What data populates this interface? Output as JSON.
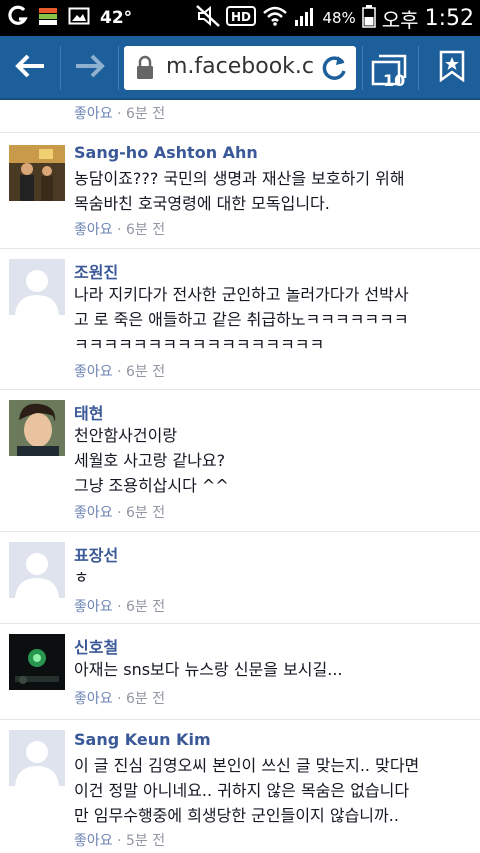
{
  "status_bar": {
    "temperature": "42°",
    "battery_percent": "48%",
    "ampm": "오후",
    "time": "1:52",
    "icons": [
      "g-icon",
      "flag-icon",
      "image-icon",
      "mute-icon",
      "hd-icon",
      "wifi-icon",
      "signal-icon",
      "battery-icon"
    ]
  },
  "browser": {
    "url": "m.facebook.c",
    "tab_count": "10",
    "colors": {
      "toolbar": "#1d5f9a",
      "url_text": "#333333"
    }
  },
  "first_meta": {
    "like": "좋아요",
    "time": "6분 전"
  },
  "comments": [
    {
      "name": "Sang-ho Ashton Ahn",
      "lines": [
        "농담이죠??? 국민의 생명과 재산을 보호하기 위해",
        "목숨바친 호국영령에 대한 모독입니다."
      ],
      "like": "좋아요",
      "time": "6분 전",
      "avatar": "photo"
    },
    {
      "name": "조원진",
      "lines": [
        "나라 지키다가 전사한 군인하고 놀러가다가 선박사",
        "고 로 죽은 애들하고 같은 취급하노ㅋㅋㅋㅋㅋㅋㅋ",
        "ㅋㅋㅋㅋㅋㅋㅋㅋㅋㅋㅋㅋㅋㅋㅋㅋㅋ"
      ],
      "like": "좋아요",
      "time": "6분 전",
      "avatar": "default"
    },
    {
      "name": "태현",
      "lines": [
        "천안함사건이랑",
        "세월호 사고랑 같나요?",
        "그냥 조용히삽시다 ^^"
      ],
      "like": "좋아요",
      "time": "6분 전",
      "avatar": "photo"
    },
    {
      "name": "표장선",
      "lines": [
        "ㅎ"
      ],
      "like": "좋아요",
      "time": "6분 전",
      "avatar": "default"
    },
    {
      "name": "신호철",
      "lines": [
        "아재는 sns보다 뉴스랑 신문을 보시길..."
      ],
      "like": "좋아요",
      "time": "6분 전",
      "avatar": "photo"
    },
    {
      "name": "Sang Keun Kim",
      "lines": [
        "이 글 진심 김영오씨 본인이 쓰신 글 맞는지.. 맞다면",
        "이건 정말 아니네요.. 귀하지 않은 목숨은 없습니다",
        "만 임무수행중에 희생당한 군인들이지 않습니까.."
      ],
      "like": "좋아요",
      "time": "5분 전",
      "avatar": "default"
    }
  ]
}
